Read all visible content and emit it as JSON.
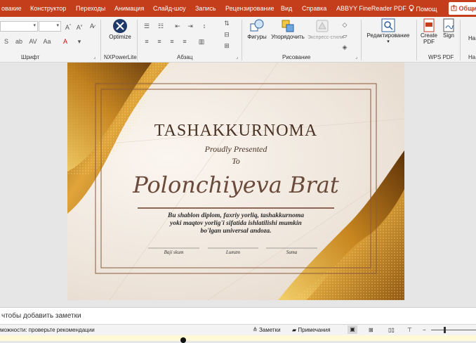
{
  "tabs": [
    "овакие",
    "Конструктор",
    "Переходы",
    "Анимация",
    "Слайд-шоу",
    "Запись",
    "Рецензирование",
    "Вид",
    "Справка",
    "ABBYY FineReader PDF"
  ],
  "help": "Помощ",
  "share": "Общи",
  "ribbon": {
    "groups": [
      "Шрифт",
      "NXPowerLite",
      "Абзац",
      "Рисование",
      "WPS PDF",
      "На",
      "На"
    ],
    "buttons": {
      "optimize": "Optimize",
      "shapes": "Фигуры",
      "arrange": "Упорядочить",
      "quick_styles": "Экспресс-стили",
      "editing": "Редактирование",
      "create_pdf": "Create PDF",
      "sign": "Sign"
    }
  },
  "slide": {
    "title": "TASHAKKURNOMA",
    "subtitle": "Proudly Presented",
    "to": "To",
    "name": "Polonchiyeva Brat",
    "body_lines": [
      "Bu shablon diplom, faxriy yorliq, tashakkurnoma",
      "yoki maqtov yorlig'i sifatida ishlatilishi mumkin",
      "bo'lgan universal andoza."
    ],
    "signatures": [
      "Bají skum",
      "Lumzm",
      "Suma"
    ]
  },
  "notes": {
    "placeholder": "чтобы добавить заметки"
  },
  "status": {
    "accessibility": "можности: проверьте рекомендации",
    "notes_btn": "Заметки",
    "comments_btn": "Примечания"
  },
  "colors": {
    "accent": "#c43e1c",
    "gold": "#c98a2a",
    "frame": "#8a5a3c",
    "title": "#4a3324",
    "name": "#6a4a3a"
  }
}
